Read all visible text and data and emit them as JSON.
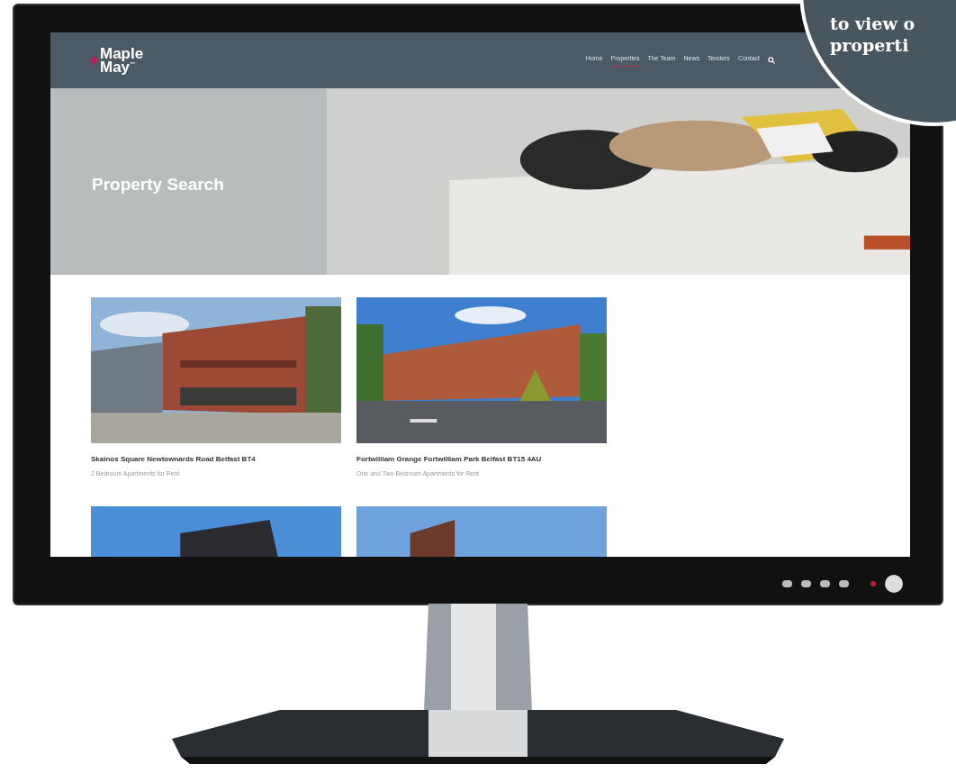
{
  "logo": {
    "line_1": "Maple",
    "line_2": "May",
    "mark": "™"
  },
  "nav": [
    {
      "label": "Home",
      "selected": false
    },
    {
      "label": "Properties",
      "selected": true
    },
    {
      "label": "The Team",
      "selected": false
    },
    {
      "label": "News",
      "selected": false
    },
    {
      "label": "Tenders",
      "selected": false
    },
    {
      "label": "Contact",
      "selected": false
    }
  ],
  "hero": {
    "title": "Property Search",
    "kind": "picture"
  },
  "properties": [
    {
      "title": "Skainos Square Newtownards Road Belfast BT4",
      "subtitle": "2 Bedroom Apartments for Rent",
      "kind": "picture"
    },
    {
      "title": "Fortwilliam Grange Fortwilliam Park Belfast BT15 4AU",
      "subtitle": "One and Two Bedroom Apartments for Rent",
      "kind": "picture"
    },
    {
      "kind": "picture"
    },
    {
      "kind": "picture"
    }
  ],
  "callout": {
    "lines": [
      "to view o",
      "properti"
    ]
  }
}
